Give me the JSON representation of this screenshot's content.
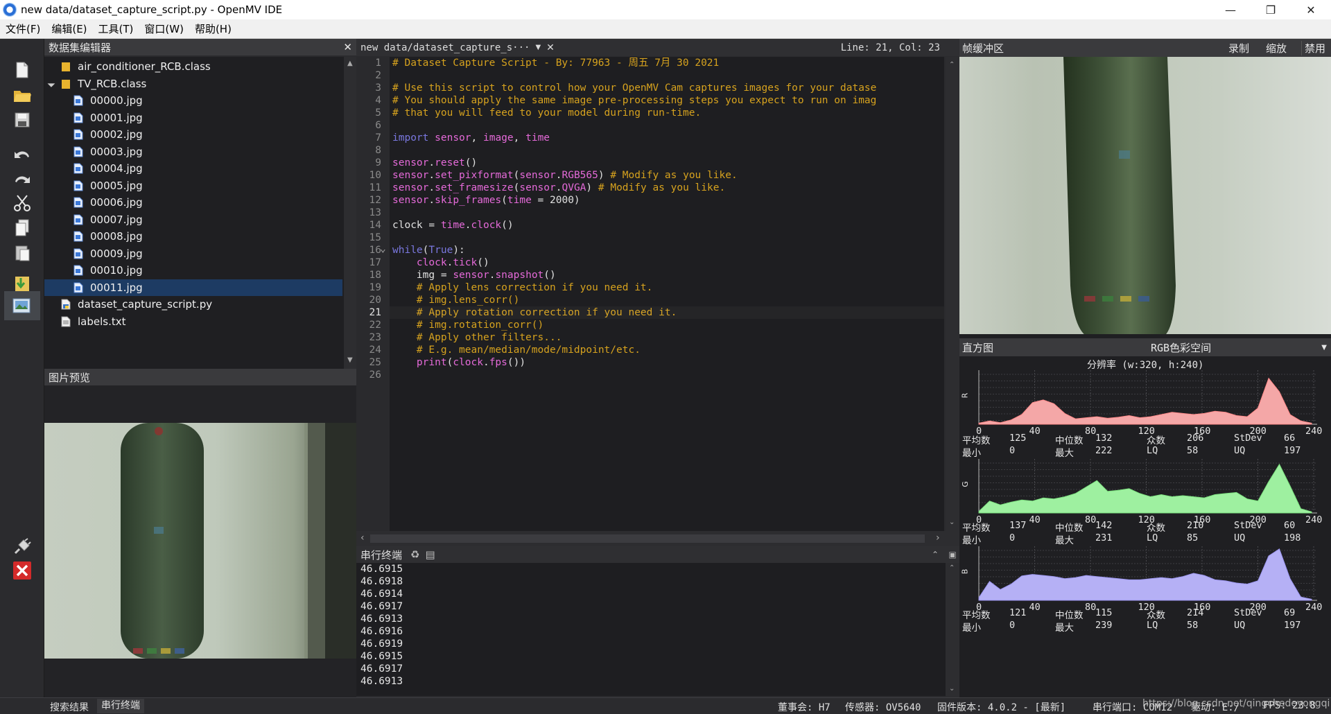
{
  "window": {
    "title": "new data/dataset_capture_script.py - OpenMV IDE"
  },
  "menu": [
    "文件(F)",
    "编辑(E)",
    "工具(T)",
    "窗口(W)",
    "帮助(H)"
  ],
  "dataset_editor": {
    "title": "数据集编辑器",
    "items": [
      {
        "label": "air_conditioner_RCB.class",
        "kind": "folder"
      },
      {
        "label": "TV_RCB.class",
        "kind": "folder-open"
      },
      {
        "label": "00000.jpg",
        "kind": "image"
      },
      {
        "label": "00001.jpg",
        "kind": "image"
      },
      {
        "label": "00002.jpg",
        "kind": "image"
      },
      {
        "label": "00003.jpg",
        "kind": "image"
      },
      {
        "label": "00004.jpg",
        "kind": "image"
      },
      {
        "label": "00005.jpg",
        "kind": "image"
      },
      {
        "label": "00006.jpg",
        "kind": "image"
      },
      {
        "label": "00007.jpg",
        "kind": "image"
      },
      {
        "label": "00008.jpg",
        "kind": "image"
      },
      {
        "label": "00009.jpg",
        "kind": "image"
      },
      {
        "label": "00010.jpg",
        "kind": "image"
      },
      {
        "label": "00011.jpg",
        "kind": "image",
        "selected": true
      },
      {
        "label": "dataset_capture_script.py",
        "kind": "script"
      },
      {
        "label": "labels.txt",
        "kind": "text"
      }
    ]
  },
  "image_preview": {
    "title": "图片预览"
  },
  "editor": {
    "tab": "new data/dataset_capture_s···",
    "cursor": "Line: 21, Col: 23",
    "current_line": 21,
    "line_numbers": [
      "1",
      "2",
      "3",
      "4",
      "5",
      "6",
      "7",
      "8",
      "9",
      "10",
      "11",
      "12",
      "13",
      "14",
      "15",
      "16",
      "17",
      "18",
      "19",
      "20",
      "21",
      "22",
      "23",
      "24",
      "25",
      "26"
    ],
    "lines": [
      "# Dataset Capture Script - By: 77963 - 周五 7月 30 2021",
      "",
      "# Use this script to control how your OpenMV Cam captures images for your datase",
      "# You should apply the same image pre-processing steps you expect to run on imag",
      "# that you will feed to your model during run-time.",
      "",
      "import sensor, image, time",
      "",
      "sensor.reset()",
      "sensor.set_pixformat(sensor.RGB565) # Modify as you like.",
      "sensor.set_framesize(sensor.QVGA) # Modify as you like.",
      "sensor.skip_frames(time = 2000)",
      "",
      "clock = time.clock()",
      "",
      "while(True):",
      "    clock.tick()",
      "    img = sensor.snapshot()",
      "    # Apply lens correction if you need it.",
      "    # img.lens_corr()",
      "    # Apply rotation correction if you need it.",
      "    # img.rotation_corr()",
      "    # Apply other filters...",
      "    # E.g. mean/median/mode/midpoint/etc.",
      "    print(clock.fps())",
      ""
    ]
  },
  "serial_terminal": {
    "title": "串行终端",
    "lines": [
      "46.6915",
      "46.6918",
      "46.6914",
      "46.6917",
      "46.6913",
      "46.6916",
      "46.6919",
      "46.6915",
      "46.6917",
      "46.6913"
    ]
  },
  "frame_buffer": {
    "title": "帧缓冲区",
    "record": "录制",
    "zoom": "缩放",
    "disable": "禁用"
  },
  "histogram": {
    "title": "直方图",
    "colorspace": "RGB色彩空间",
    "resolution": "分辨率 (w:320, h:240)",
    "ticks": [
      "0",
      "40",
      "80",
      "120",
      "160",
      "200",
      "240"
    ],
    "labels": {
      "mean": "平均数",
      "median": "中位数",
      "mode": "众数",
      "stdev": "StDev",
      "min": "最小",
      "max": "最大",
      "lq": "LQ",
      "uq": "UQ"
    },
    "channels": [
      {
        "name": "R",
        "color": "#f4a7a7",
        "stroke": "#ff8a8a",
        "mean": "125",
        "median": "132",
        "mode": "206",
        "stdev": "66",
        "min": "0",
        "max": "222",
        "lq": "58",
        "uq": "197"
      },
      {
        "name": "G",
        "color": "#9ef0a0",
        "stroke": "#7be07e",
        "mean": "137",
        "median": "142",
        "mode": "210",
        "stdev": "60",
        "min": "0",
        "max": "231",
        "lq": "85",
        "uq": "198"
      },
      {
        "name": "B",
        "color": "#b5b0f5",
        "stroke": "#9c96f0",
        "mean": "121",
        "median": "115",
        "mode": "214",
        "stdev": "69",
        "min": "0",
        "max": "239",
        "lq": "58",
        "uq": "197"
      }
    ]
  },
  "statusbar": {
    "search": "搜索结果",
    "serial": "串行终端",
    "board": "董事会: H7",
    "sensor": "传感器: OV5640",
    "firmware": "固件版本: 4.0.2 - [最新]",
    "port": "串行端口: COM12",
    "drive": "驱动: E:/",
    "fps": "FPS: 23.8",
    "watermark": "https://blog.csdn.net/qingchedeyongqi"
  }
}
